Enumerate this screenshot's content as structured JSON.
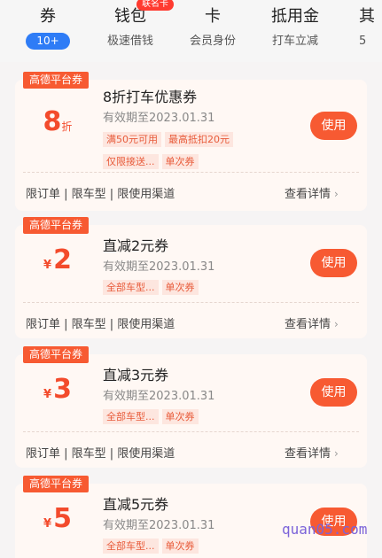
{
  "tabs": [
    {
      "label": "券",
      "sub": "10+"
    },
    {
      "label": "钱包",
      "sub": "极速借钱",
      "badge": "联名卡"
    },
    {
      "label": "卡",
      "sub": "会员身份"
    },
    {
      "label": "抵用金",
      "sub": "打车立减"
    },
    {
      "label": "其",
      "sub": "5"
    }
  ],
  "coupons": [
    {
      "tag": "高德平台券",
      "amount": "8",
      "unit": "折",
      "title": "8折打车优惠券",
      "valid": "有效期至2023.01.31",
      "chips": [
        "满50元可用",
        "最高抵扣20元",
        "仅限接送...",
        "单次券"
      ],
      "use": "使用",
      "restrict": "限订单 | 限车型 | 限使用渠道",
      "detail": "查看详情"
    },
    {
      "tag": "高德平台券",
      "currency": "¥",
      "amount": "2",
      "title": "直减2元券",
      "valid": "有效期至2023.01.31",
      "chips": [
        "全部车型...",
        "单次券"
      ],
      "use": "使用",
      "restrict": "限订单 | 限车型 | 限使用渠道",
      "detail": "查看详情"
    },
    {
      "tag": "高德平台券",
      "currency": "¥",
      "amount": "3",
      "title": "直减3元券",
      "valid": "有效期至2023.01.31",
      "chips": [
        "全部车型...",
        "单次券"
      ],
      "use": "使用",
      "restrict": "限订单 | 限车型 | 限使用渠道",
      "detail": "查看详情"
    },
    {
      "tag": "高德平台券",
      "currency": "¥",
      "amount": "5",
      "title": "直减5元券",
      "valid": "有效期至2023.01.31",
      "chips": [
        "全部车型...",
        "单次券"
      ],
      "use": "使用"
    }
  ],
  "watermark": "quan05.com",
  "colors": {
    "accent": "#f75a32",
    "active_pill": "#2e7cf6",
    "card_bg": "#fff8f4"
  }
}
